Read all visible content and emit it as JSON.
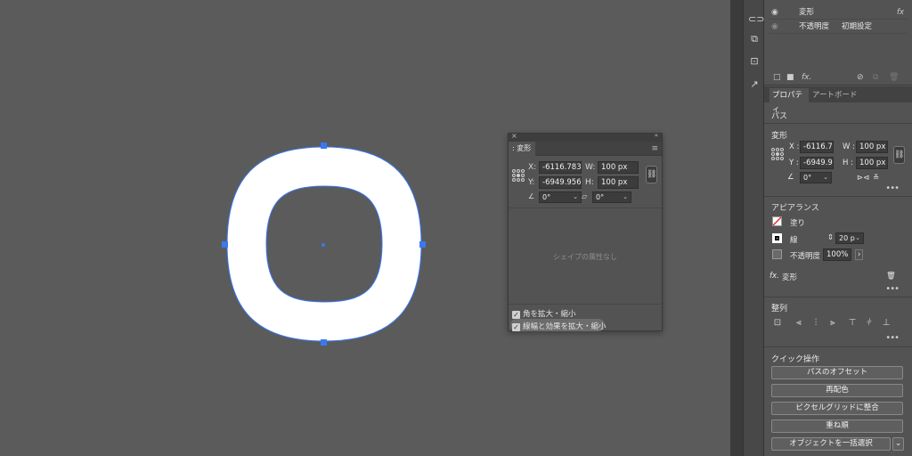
{
  "transform_panel": {
    "title": "変形",
    "x_label": "X:",
    "x_value": "-6116.7837",
    "y_label": "Y:",
    "y_value": "-6949.956",
    "w_label": "W:",
    "w_value": "100 px",
    "h_label": "H:",
    "h_value": "100 px",
    "rotate_value": "0°",
    "shear_value": "0°",
    "empty_text": "シェイプの属性なし",
    "scale_corners": "角を拡大・縮小",
    "scale_strokes": "線幅と効果を拡大・縮小"
  },
  "appearance": {
    "row1_label": "変形",
    "row2_label": "不透明度",
    "row2_value": "初期設定",
    "fx": "fx"
  },
  "properties": {
    "tab_properties": "プロパティ",
    "tab_artboard": "アートボード",
    "selection_type": "パス",
    "transform_title": "変形",
    "x_label": "X :",
    "x_value": "-6116.7",
    "y_label": "Y :",
    "y_value": "-6949.9",
    "w_label": "W :",
    "w_value": "100 px",
    "h_label": "H :",
    "h_value": "100 px",
    "rotate_value": "0°",
    "appearance_title": "アピアランス",
    "fill_label": "塗り",
    "stroke_label": "線",
    "stroke_value": "20 p",
    "opacity_label": "不透明度",
    "opacity_value": "100%",
    "effect_label": "変形",
    "align_title": "整列",
    "quick_title": "クイック操作",
    "btn_offset": "パスのオフセット",
    "btn_recolor": "再配色",
    "btn_pixel": "ピクセルグリッドに整合",
    "btn_arrange": "重ね順",
    "btn_select_same": "オブジェクトを一括選択"
  },
  "colors": {
    "selection": "#3a78f2",
    "canvas": "#5b5b5b",
    "panel": "#535353",
    "shape_fill": "#ffffff"
  }
}
